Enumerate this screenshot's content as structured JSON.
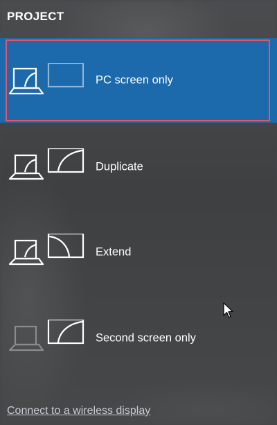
{
  "header": {
    "title": "PROJECT"
  },
  "options": [
    {
      "label": "PC screen only",
      "icon": "pc-screen-only-icon",
      "selected": true
    },
    {
      "label": "Duplicate",
      "icon": "duplicate-icon",
      "selected": false
    },
    {
      "label": "Extend",
      "icon": "extend-icon",
      "selected": false
    },
    {
      "label": "Second screen only",
      "icon": "second-screen-only-icon",
      "selected": false
    }
  ],
  "footer": {
    "link_label": "Connect to a wireless display"
  },
  "colors": {
    "selected_bg": "#1c6aab",
    "focus_border": "#e0566a",
    "panel_bg": "#444648"
  }
}
